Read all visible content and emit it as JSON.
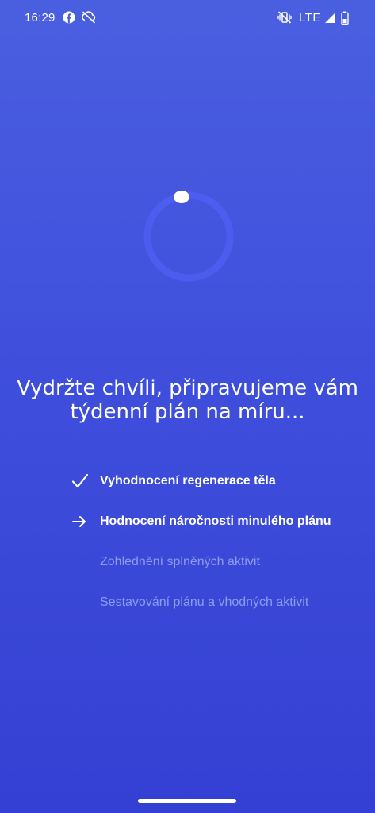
{
  "status_bar": {
    "time": "16:29",
    "network": "LTE",
    "icons": [
      "facebook-icon",
      "sync-off-icon",
      "vibrate-off-icon",
      "signal-icon",
      "battery-icon"
    ]
  },
  "loader": {
    "icon": "loading-spinner-icon"
  },
  "headline": "Vydržte chvíli, připravujeme vám týdenní plán na míru...",
  "steps": [
    {
      "label": "Vyhodnocení regenerace těla",
      "state": "done",
      "icon": "checkmark-icon"
    },
    {
      "label": "Hodnocení náročnosti minulého plánu",
      "state": "active",
      "icon": "arrow-right-icon"
    },
    {
      "label": "Zohlednění splněných aktivit",
      "state": "pending",
      "icon": ""
    },
    {
      "label": "Sestavování plánu a vhodných aktivit",
      "state": "pending",
      "icon": ""
    }
  ],
  "colors": {
    "background_top": "#4a5fe0",
    "background_bottom": "#3440d3",
    "text_primary": "#ffffff",
    "text_pending": "#8c9bf0",
    "spinner_track": "#4d5ef2"
  }
}
